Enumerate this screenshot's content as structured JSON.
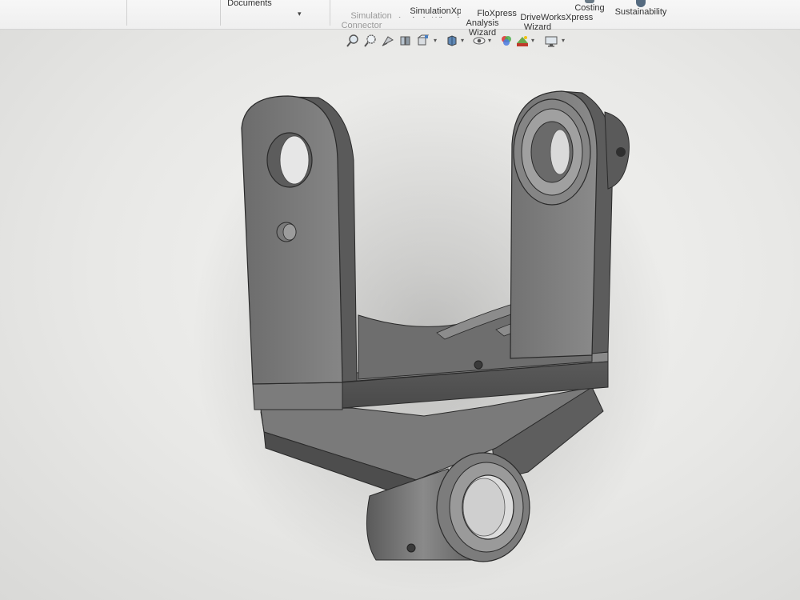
{
  "ribbon": {
    "documents_label": "Documents",
    "simulation_connector_label": "Simulation\nConnector",
    "simulationxpress_label": "SimulationXpress\nAnalysis Wizard",
    "floxpress_label": "FloXpress\nAnalysis\nWizard",
    "driveworksxpress_label": "DriveWorksXpress\nWizard",
    "costing_label": "Costing",
    "sustainability_label": "Sustainability"
  },
  "hud": {
    "tools": [
      "zoom-to-fit-icon",
      "zoom-to-area-icon",
      "previous-view-icon",
      "section-view-icon",
      "view-orientation-icon",
      "display-style-icon",
      "hide-show-items-icon",
      "edit-appearance-icon",
      "apply-scene-icon",
      "view-settings-icon"
    ]
  },
  "colors": {
    "part_light": "#8e8e8e",
    "part_mid": "#6e6e6e",
    "part_dark": "#4a4a4a",
    "edge": "#2a2a2a",
    "background": "#ececea"
  }
}
